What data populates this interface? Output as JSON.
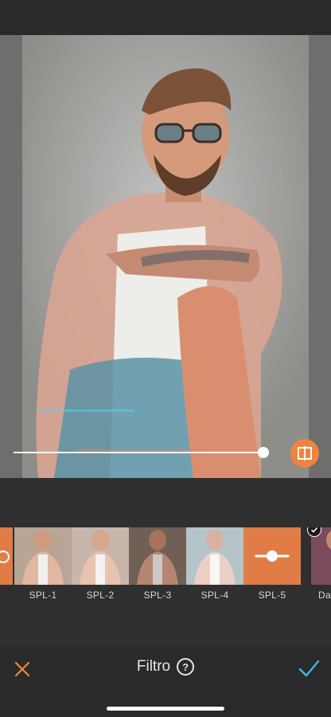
{
  "editor": {
    "intensity": 0.97,
    "compare_icon": "split-compare-icon"
  },
  "filters": [
    {
      "label": "",
      "state": "partial"
    },
    {
      "label": "SPL-1"
    },
    {
      "label": "SPL-2"
    },
    {
      "label": "SPL-3"
    },
    {
      "label": "SPL-4"
    },
    {
      "label": "SPL-5",
      "selected": true
    },
    {
      "label": "Day",
      "badge": "check"
    }
  ],
  "bottom_bar": {
    "title": "Filtro",
    "help_icon": "?",
    "cancel_icon": "close-icon",
    "confirm_icon": "checkmark-icon"
  },
  "colors": {
    "accent": "#f0843f",
    "confirm": "#3fb6e8",
    "bar": "#2a2a2a"
  }
}
